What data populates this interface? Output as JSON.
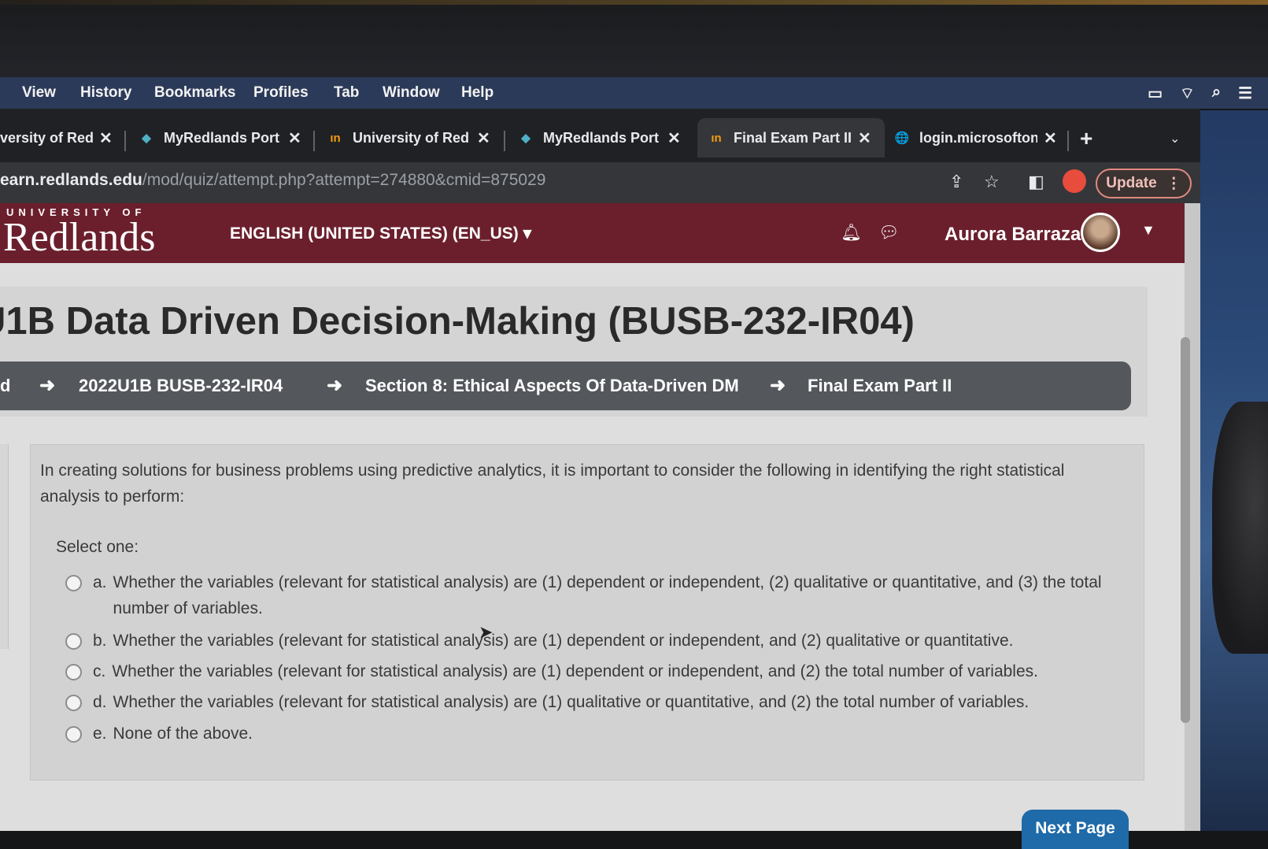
{
  "menubar": {
    "items": [
      "View",
      "History",
      "Bookmarks",
      "Profiles",
      "Tab",
      "Window",
      "Help"
    ]
  },
  "tabs": [
    {
      "label": "versity of Red",
      "favicon": "",
      "close": "✕"
    },
    {
      "label": "MyRedlands Port",
      "favicon": "◆",
      "close": "✕"
    },
    {
      "label": "University of Red",
      "favicon": "ın",
      "close": "✕"
    },
    {
      "label": "MyRedlands Port",
      "favicon": "◆",
      "close": "✕"
    },
    {
      "label": "Final Exam Part II",
      "favicon": "ın",
      "close": "✕"
    },
    {
      "label": "login.microsofton",
      "favicon": "🌐",
      "close": "✕"
    }
  ],
  "browser": {
    "new_tab": "+",
    "tab_search": "⌄",
    "url_host": "earn.redlands.edu",
    "url_path": "/mod/quiz/attempt.php?attempt=274880&cmid=875029",
    "update_label": "Update"
  },
  "site": {
    "logo_top": "UNIVERSITY OF",
    "logo_main": "Redlands",
    "language": "ENGLISH (UNITED STATES) (EN_US) ▾",
    "user_name": "Aurora Barraza"
  },
  "course": {
    "title": "U1B Data Driven Decision-Making (BUSB-232-IR04)",
    "breadcrumb": [
      "d",
      "2022U1B BUSB-232-IR04",
      "Section 8: Ethical Aspects Of Data-Driven DM",
      "Final Exam Part II"
    ]
  },
  "question": {
    "text": "In creating solutions for business problems using predictive analytics, it is important to consider the following in identifying the right statistical analysis to perform:",
    "select_label": "Select one:",
    "options": [
      {
        "letter": "a.",
        "text": "Whether the variables (relevant for statistical analysis) are (1) dependent or independent, (2) qualitative or quantitative, and (3) the total number of variables."
      },
      {
        "letter": "b.",
        "text": "Whether the variables (relevant for statistical analysis) are (1) dependent or independent, and (2) qualitative or quantitative."
      },
      {
        "letter": "c.",
        "text": "Whether the variables (relevant for statistical analysis) are (1) dependent or independent, and (2) the total number of variables."
      },
      {
        "letter": "d.",
        "text": "Whether the variables (relevant for statistical analysis) are (1) qualitative or quantitative, and (2) the total number of variables."
      },
      {
        "letter": "e.",
        "text": "None of the above."
      }
    ]
  },
  "nav": {
    "next_label": "Next Page"
  }
}
